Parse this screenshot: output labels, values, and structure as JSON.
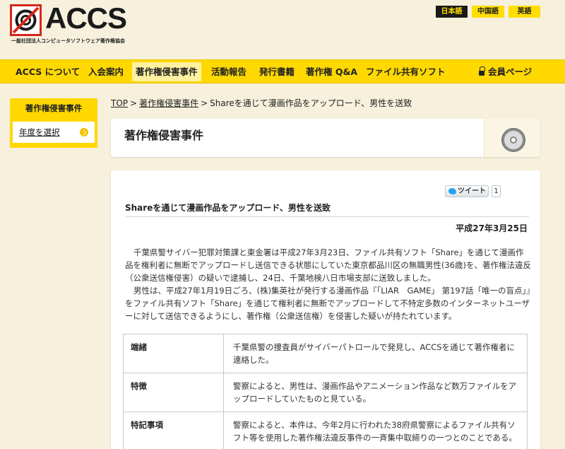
{
  "header": {
    "logo_text": "ACCS",
    "logo_sub": "一般社団法人コンピュータソフトウェア著作権協会",
    "languages": [
      "日本語",
      "中国語",
      "英語"
    ]
  },
  "nav": {
    "items": [
      "ACCS について",
      "入会案内",
      "著作権侵害事件",
      "活動報告",
      "発行書籍",
      "著作権 Q&A",
      "ファイル共有ソフト"
    ],
    "member": "会員ページ"
  },
  "sidebar": {
    "heading": "著作権侵害事件",
    "link": "年度を選択"
  },
  "breadcrumb": {
    "home": "TOP",
    "section": "著作権侵害事件",
    "sep": ">",
    "current": "Shareを通じて漫画作品をアップロード、男性を送致"
  },
  "page_title": "著作権侵害事件",
  "article": {
    "tweet_label": "ツイート",
    "tweet_count": "1",
    "title": "Shareを通じて漫画作品をアップロード、男性を送致",
    "date": "平成27年3月25日",
    "paragraphs": [
      "千葉県警サイバー犯罪対策課と東金署は平成27年3月23日、ファイル共有ソフト「Share」を通じて漫画作品を権利者に無断でアップロードし送信できる状態にしていた東京都品川区の無職男性(36歳)を、著作権法違反（公衆送信権侵害）の疑いで逮捕し、24日、千葉地検八日市場支部に送致しました。",
      "男性は、平成27年1月19日ごろ、(株)集英社が発行する漫画作品『「LIAR　GAME」 第197話「唯一の盲点」』をファイル共有ソフト「Share」を通じて権利者に無断でアップロードして不特定多数のインターネットユーザーに対して送信できるようにし、著作権（公衆送信権）を侵害した疑いが持たれています。"
    ],
    "details": [
      {
        "key": "端緒",
        "value": "千葉県警の捜査員がサイバーパトロールで発見し、ACCSを通じて著作権者に連絡した。"
      },
      {
        "key": "特徴",
        "value": "警察によると、男性は、漫画作品やアニメーション作品など数万ファイルをアップロードしていたものと見ている。"
      },
      {
        "key": "特記事項",
        "value": "警察によると、本件は、今年2月に行われた38府県警察によるファイル共有ソフト等を使用した著作権法違反事件の一斉集中取締りの一つとのことである。"
      }
    ]
  },
  "colors": {
    "brand_yellow": "#ffd800",
    "background": "#f6f0dc",
    "logo_red": "#d7261b"
  }
}
